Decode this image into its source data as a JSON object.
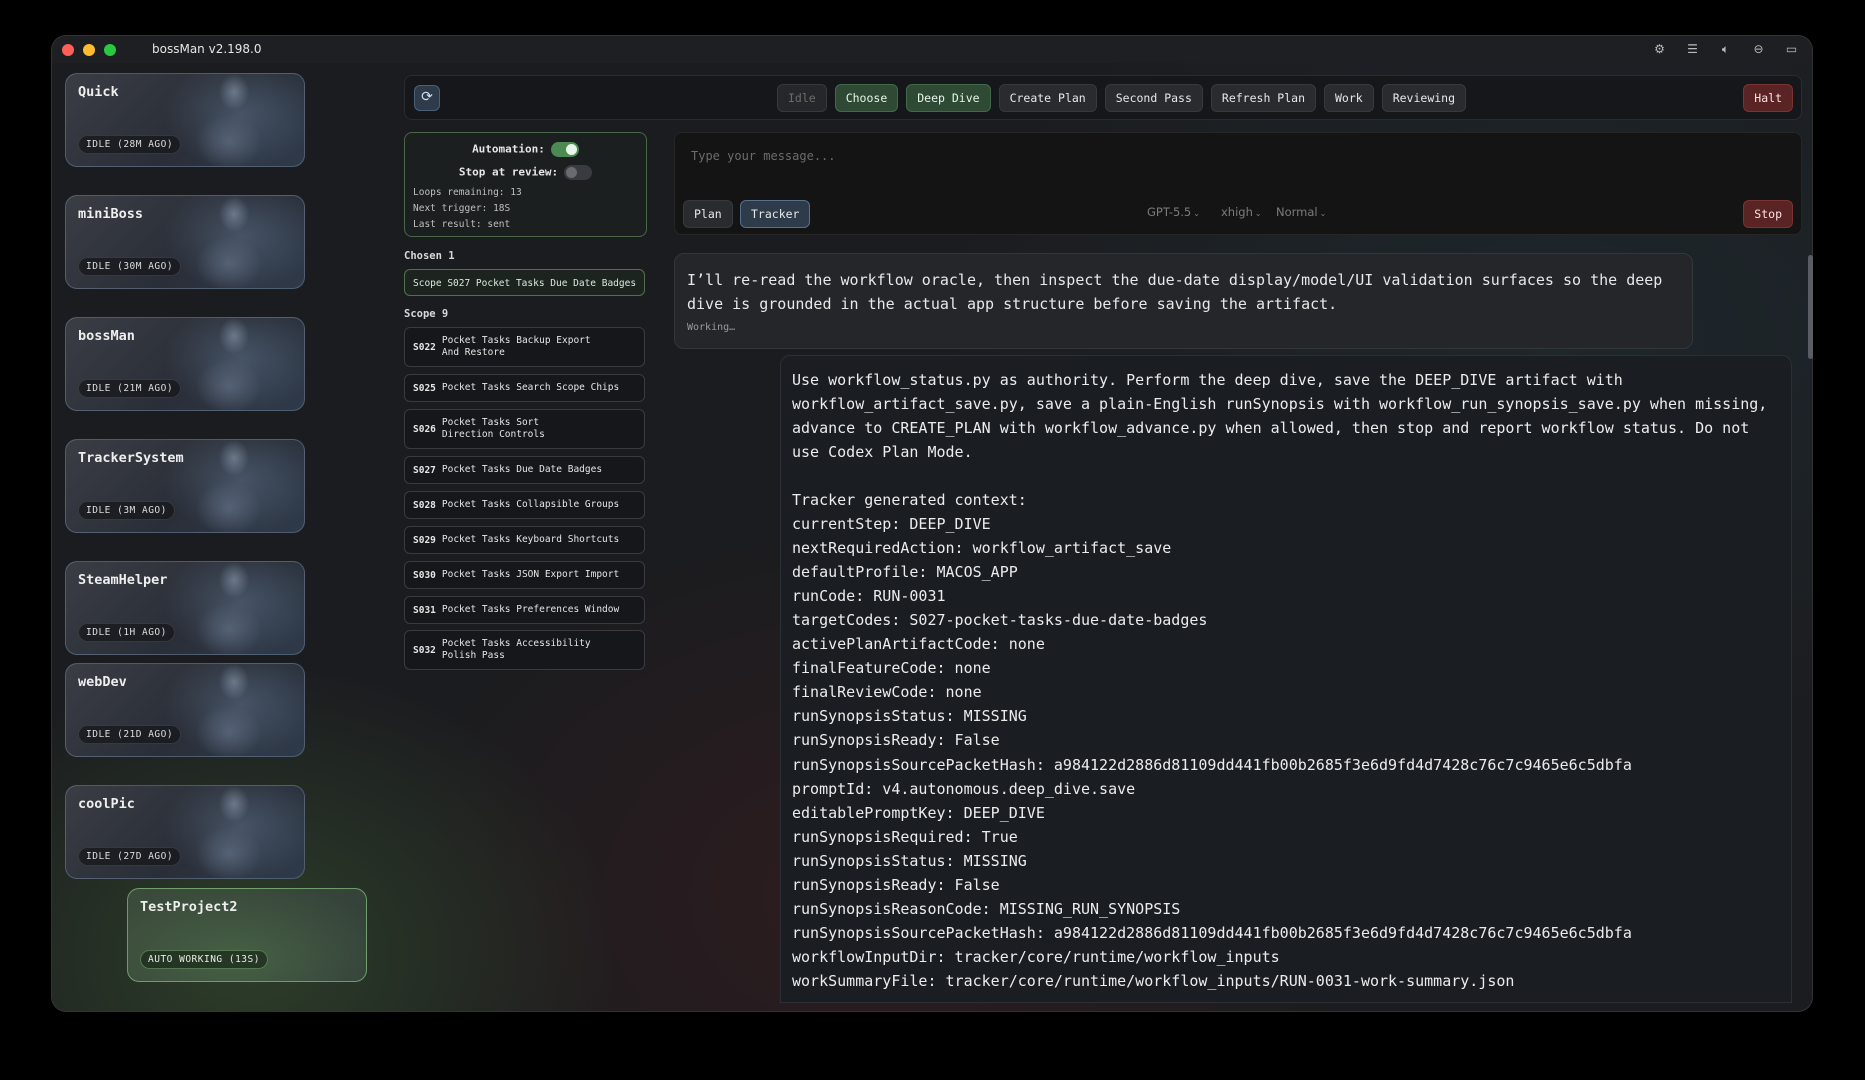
{
  "app": {
    "title": "bossMan v2.198.0"
  },
  "titlebar_icons": [
    "gear-icon",
    "list-icon",
    "speaker-icon",
    "minus-circle-icon",
    "chat-icon"
  ],
  "projects": [
    {
      "name": "Quick",
      "status": "IDLE (28M AGO)"
    },
    {
      "name": "miniBoss",
      "status": "IDLE (30M AGO)"
    },
    {
      "name": "bossMan",
      "status": "IDLE (21M AGO)"
    },
    {
      "name": "TrackerSystem",
      "status": "IDLE (3M AGO)"
    },
    {
      "name": "SteamHelper",
      "status": "IDLE (1H AGO)"
    },
    {
      "name": "webDev",
      "status": "IDLE (21D AGO)"
    },
    {
      "name": "coolPic",
      "status": "IDLE (27D AGO)"
    },
    {
      "name": "TestProject2",
      "status": "AUTO WORKING (13S)"
    }
  ],
  "toolbar": {
    "steps": [
      "Idle",
      "Choose",
      "Deep Dive",
      "Create Plan",
      "Second Pass",
      "Refresh Plan",
      "Work",
      "Reviewing"
    ],
    "halt": "Halt"
  },
  "automation": {
    "label": "Automation:",
    "enabled": true,
    "stop_label": "Stop at review:",
    "stop_enabled": false,
    "loops": "Loops remaining: 13",
    "next": "Next trigger: 18S",
    "last": "Last result: sent"
  },
  "chosen": {
    "label": "Chosen 1",
    "item": "Scope S027 Pocket Tasks Due Date Badges"
  },
  "scope": {
    "label": "Scope 9",
    "items": [
      {
        "code": "S022",
        "title": "Pocket Tasks Backup Export And Restore"
      },
      {
        "code": "S025",
        "title": "Pocket Tasks Search Scope Chips"
      },
      {
        "code": "S026",
        "title": "Pocket Tasks Sort Direction Controls"
      },
      {
        "code": "S027",
        "title": "Pocket Tasks Due Date Badges"
      },
      {
        "code": "S028",
        "title": "Pocket Tasks Collapsible Groups"
      },
      {
        "code": "S029",
        "title": "Pocket Tasks Keyboard Shortcuts"
      },
      {
        "code": "S030",
        "title": "Pocket Tasks JSON Export Import"
      },
      {
        "code": "S031",
        "title": "Pocket Tasks Preferences Window"
      },
      {
        "code": "S032",
        "title": "Pocket Tasks Accessibility Polish Pass"
      }
    ]
  },
  "composer": {
    "placeholder": "Type your message...",
    "plan": "Plan",
    "tracker": "Tracker",
    "model": "GPT-5.5",
    "effort": "xhigh",
    "speed": "Normal",
    "stop": "Stop"
  },
  "assistant_message": {
    "text": "I’ll re-read the workflow oracle, then inspect the due-date display/model/UI validation surfaces so the deep dive is grounded in the actual app structure before saving the artifact.",
    "status": "Working…"
  },
  "user_message": {
    "instruction": "Use workflow_status.py as authority. Perform the deep dive, save the DEEP_DIVE artifact with workflow_artifact_save.py, save a plain-English runSynopsis with workflow_run_synopsis_save.py when missing, advance to CREATE_PLAN with workflow_advance.py when allowed, then stop and report workflow status. Do not use Codex Plan Mode.",
    "context_lines": [
      "Tracker generated context:",
      "currentStep: DEEP_DIVE",
      "nextRequiredAction: workflow_artifact_save",
      "defaultProfile: MACOS_APP",
      "runCode: RUN-0031",
      "targetCodes: S027-pocket-tasks-due-date-badges",
      "activePlanArtifactCode: none",
      "finalFeatureCode: none",
      "finalReviewCode: none",
      "runSynopsisStatus: MISSING",
      "runSynopsisReady: False",
      "runSynopsisSourcePacketHash: a984122d2886d81109dd441fb00b2685f3e6d9fd4d7428c76c7c9465e6c5dbfa",
      "promptId: v4.autonomous.deep_dive.save",
      "editablePromptKey: DEEP_DIVE",
      "runSynopsisRequired: True",
      "runSynopsisStatus: MISSING",
      "runSynopsisReady: False",
      "runSynopsisReasonCode: MISSING_RUN_SYNOPSIS",
      "runSynopsisSourcePacketHash: a984122d2886d81109dd441fb00b2685f3e6d9fd4d7428c76c7c9465e6c5dbfa",
      "workflowInputDir: tracker/core/runtime/workflow_inputs",
      "workSummaryFile: tracker/core/runtime/workflow_inputs/RUN-0031-work-summary.json"
    ]
  }
}
